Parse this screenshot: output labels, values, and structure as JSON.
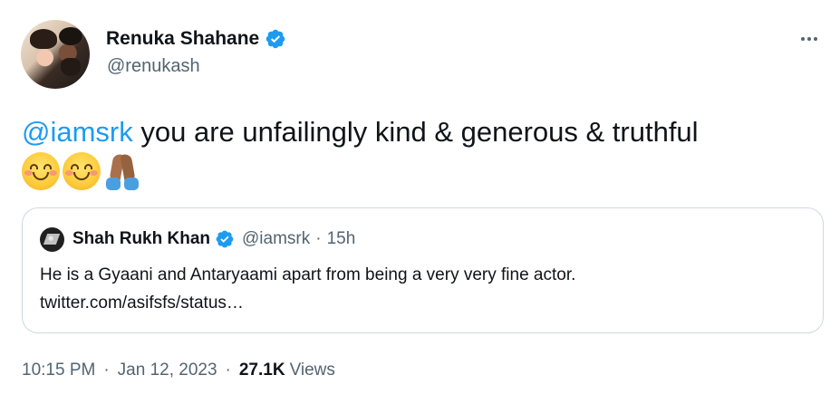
{
  "author": {
    "display_name": "Renuka Shahane",
    "handle": "@renukash",
    "verified": true
  },
  "tweet": {
    "mention": "@iamsrk",
    "text": " you are unfailingly kind & generous & truthful",
    "emojis": [
      "smiling-face-with-smiling-eyes",
      "smiling-face-with-smiling-eyes",
      "folded-hands"
    ]
  },
  "quoted_tweet": {
    "display_name": "Shah Rukh Khan",
    "handle": "@iamsrk",
    "separator": "·",
    "time": "15h",
    "verified": true,
    "text_line1": "He is a Gyaani and Antaryaami apart from being a very very fine actor.",
    "text_line2": "twitter.com/asifsfs/status…"
  },
  "meta": {
    "time": "10:15 PM",
    "separator": "·",
    "date": "Jan 12, 2023",
    "views_count": "27.1K",
    "views_label": "Views"
  },
  "colors": {
    "accent": "#1d9bf0",
    "text": "#0f1419",
    "secondary": "#536471",
    "border": "#cfd9de"
  },
  "icons": {
    "verified": "verified-badge-icon",
    "more": "more-options-icon"
  }
}
